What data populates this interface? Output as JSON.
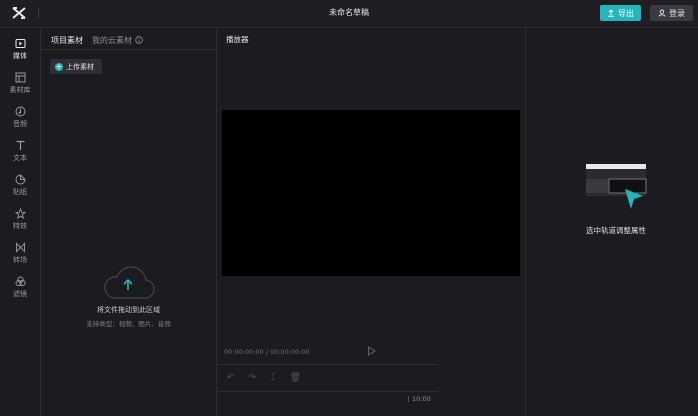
{
  "header": {
    "title": "未命名草稿",
    "export_label": "导出",
    "login_label": "登录"
  },
  "sidebar": {
    "items": [
      {
        "label": "媒体",
        "icon": "media-icon"
      },
      {
        "label": "素材库",
        "icon": "library-icon"
      },
      {
        "label": "音频",
        "icon": "audio-icon"
      },
      {
        "label": "文本",
        "icon": "text-icon"
      },
      {
        "label": "贴纸",
        "icon": "sticker-icon"
      },
      {
        "label": "特效",
        "icon": "effects-icon"
      },
      {
        "label": "转场",
        "icon": "transition-icon"
      },
      {
        "label": "滤镜",
        "icon": "filter-icon"
      }
    ]
  },
  "media": {
    "tabs": [
      "项目素材",
      "我的云素材"
    ],
    "upload_label": "上传素材",
    "drop_title": "将文件拖动到此区域",
    "drop_sub": "支持类型：视频、图片、音频"
  },
  "player": {
    "title": "播放器",
    "time": "00:00:00:00 / 00:00:00:00",
    "ruler_label": "10:00"
  },
  "properties": {
    "hint": "选中轨道调整属性"
  },
  "colors": {
    "accent": "#23b6bd",
    "background": "#1b1b20"
  }
}
